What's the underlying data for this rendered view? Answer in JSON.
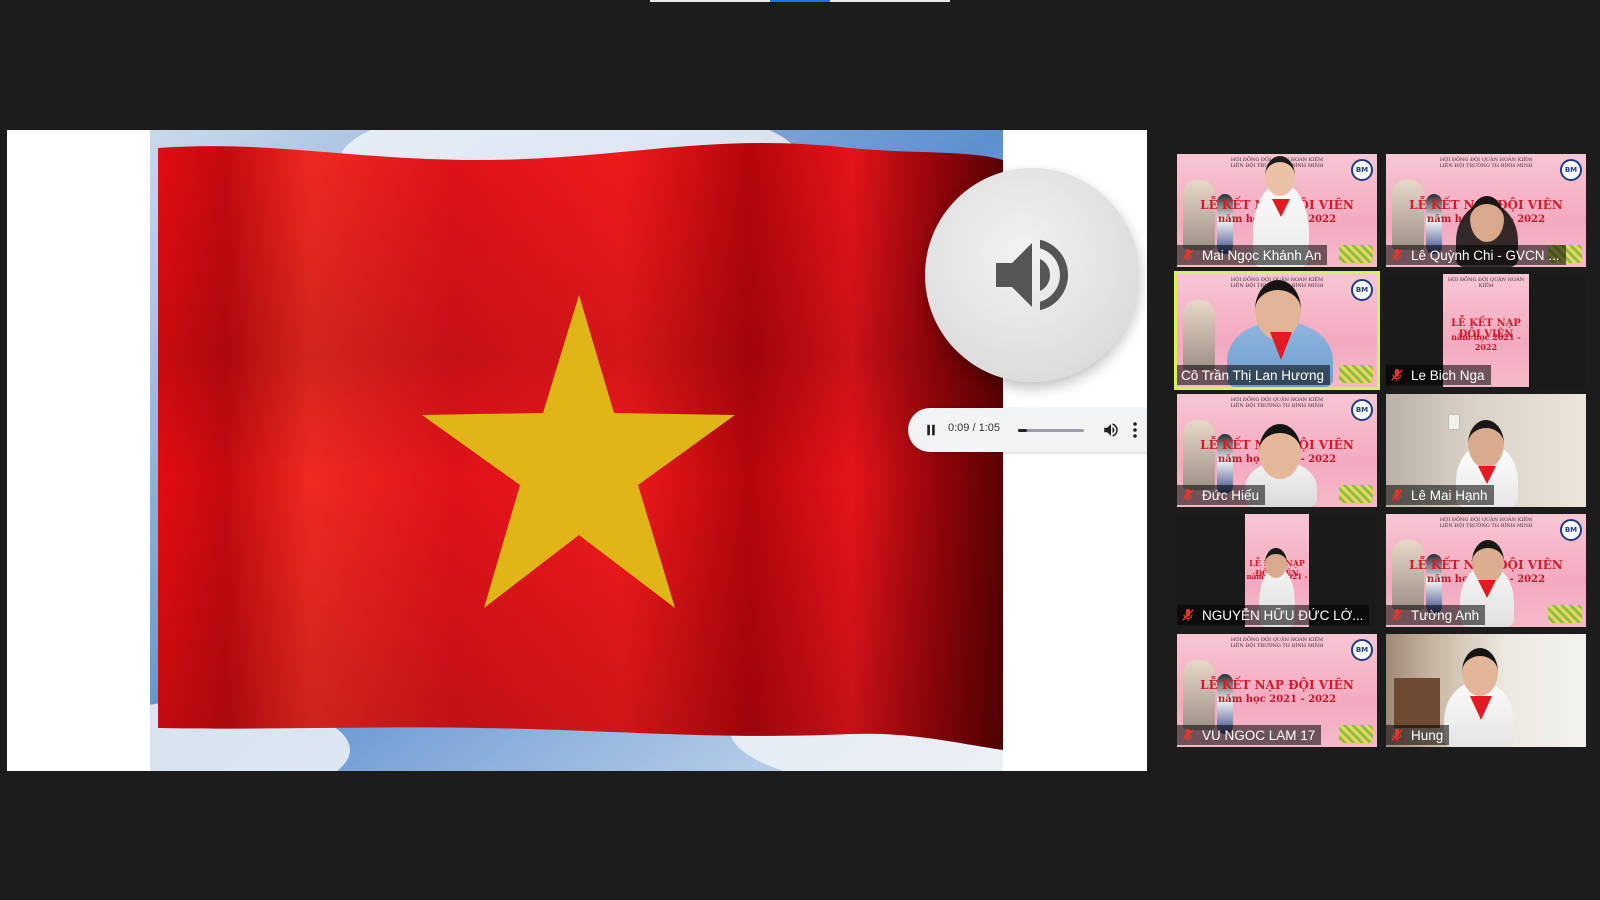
{
  "audio_player": {
    "time_label": "0:09 / 1:05",
    "progress_fraction": 0.14
  },
  "participants": [
    {
      "name": "Mai Ngọc Khánh An",
      "muted": true,
      "active": false
    },
    {
      "name": "Lê Quỳnh Chi - GVCN ...",
      "muted": true,
      "active": false
    },
    {
      "name": "Cô Trần Thị Lan Hương",
      "muted": false,
      "active": true
    },
    {
      "name": "Le Bich Nga",
      "muted": true,
      "active": false
    },
    {
      "name": "Đức Hiếu",
      "muted": true,
      "active": false
    },
    {
      "name": "Lê Mai Hạnh",
      "muted": true,
      "active": false
    },
    {
      "name": "NGUYỄN HỮU ĐỨC LỚ...",
      "muted": true,
      "active": false
    },
    {
      "name": "Tường Anh",
      "muted": true,
      "active": false
    },
    {
      "name": "VU NGOC LAM 17",
      "muted": true,
      "active": false
    },
    {
      "name": "Hung",
      "muted": true,
      "active": false
    }
  ],
  "poster": {
    "header_line1": "HỘI ĐỒNG ĐỘI QUẬN HOÀN KIẾM",
    "header_line2": "LIÊN ĐỘI TRƯỜNG TH BÌNH MINH",
    "title": "LỄ KẾT NẠP ĐỘI VIÊN",
    "subtitle": "năm học 2021 - 2022",
    "logo": "BM"
  },
  "colors": {
    "background": "#1c1c1c",
    "flag_red": "#e30d13",
    "flag_star": "#f2c519",
    "active_speaker_outline": "#d7f05c",
    "mute_icon": "#e0382b"
  }
}
